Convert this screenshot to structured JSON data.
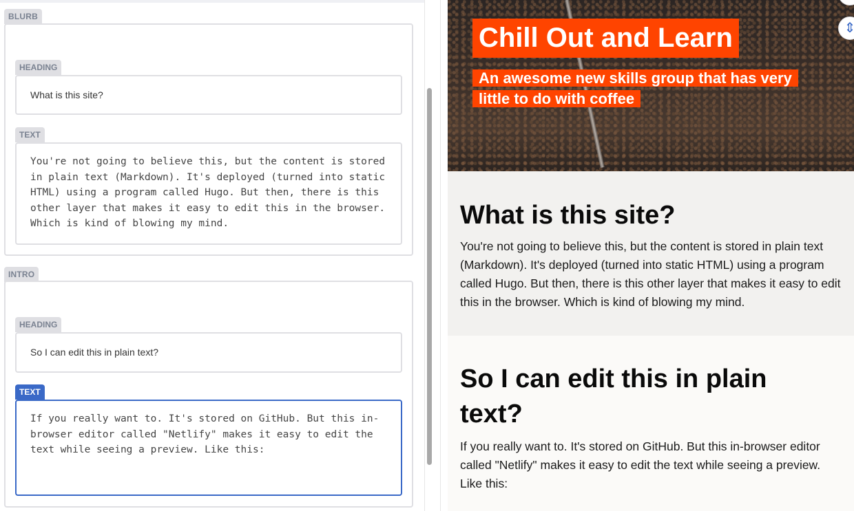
{
  "editor": {
    "blurb": {
      "section_label": "BLURB",
      "heading_label": "HEADING",
      "heading_value": "What is this site?",
      "text_label": "TEXT",
      "text_value": "You're not going to believe this, but the content is stored in plain text (Markdown). It's deployed (turned into static HTML) using a program called Hugo. But then, there is this other layer that makes it easy to edit this in the browser. Which is kind of blowing my mind."
    },
    "intro": {
      "section_label": "INTRO",
      "heading_label": "HEADING",
      "heading_value": "So I can edit this in plain text?",
      "text_label": "TEXT",
      "text_value": "If you really want to. It's stored on GitHub. But this in-browser editor called \"Netlify\" makes it easy to edit the text while seeing a preview. Like this:"
    }
  },
  "preview": {
    "hero": {
      "title": "Chill Out and Learn",
      "subtitle": "An awesome new skills group that has very little to do with coffee"
    },
    "blurb": {
      "heading": "What is this site?",
      "text": "You're not going to believe this, but the content is stored in plain text (Markdown). It's deployed (turned into static HTML) using a program called Hugo. But then, there is this other layer that makes it easy to edit this in the browser. Which is kind of blowing my mind."
    },
    "intro": {
      "heading": "So I can edit this in plain text?",
      "text": "If you really want to. It's stored on GitHub. But this in-browser editor called \"Netlify\" makes it easy to edit the text while seeing a preview. Like this:"
    },
    "controls": {
      "sync_icon": "scroll-sync-icon",
      "sync_glyph": "⇕"
    }
  },
  "colors": {
    "accent": "#3a69c7",
    "hero_highlight": "#ff4400",
    "label_bg": "#dfdfe3"
  }
}
